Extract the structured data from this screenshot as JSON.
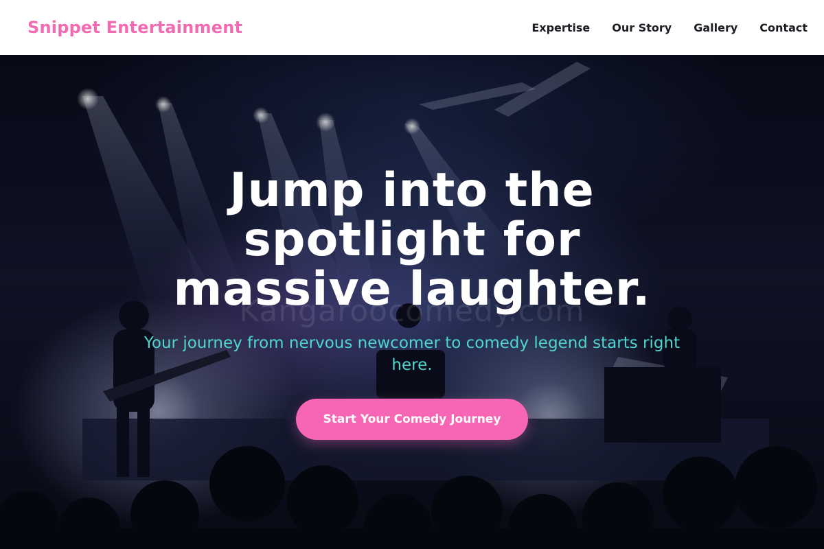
{
  "navbar": {
    "brand": "Snippet Entertainment",
    "links": [
      "Expertise",
      "Our Story",
      "Gallery",
      "Contact"
    ]
  },
  "hero": {
    "headline": "Jump into the spotlight for massive laughter.",
    "watermark": "Kangaroocomedy.com",
    "subtitle": "Your journey from nervous newcomer to comedy legend starts right here.",
    "cta_label": "Start Your Comedy Journey"
  },
  "colors": {
    "brand": "#f26bb2",
    "accent_button": "#f766b4",
    "subtitle_teal": "#4fd6cf",
    "nav_text": "#1c1c24"
  },
  "icons": {
    "hero_background": "concert-stage-photo"
  }
}
